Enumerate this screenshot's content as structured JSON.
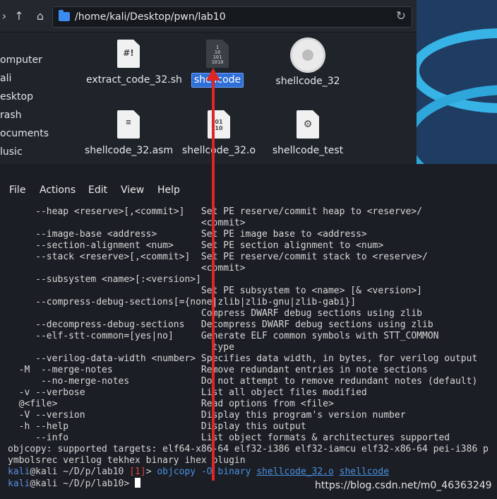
{
  "file_manager": {
    "path": "/home/kali/Desktop/pwn/lab10",
    "sidebar": [
      "omputer",
      "ali",
      "esktop",
      "rash",
      "ocuments",
      "lusic"
    ],
    "files": [
      {
        "name": "extract_code_32.sh",
        "icon": "script-file-icon"
      },
      {
        "name": "shellcode",
        "icon": "binary-file-icon",
        "selected": true
      },
      {
        "name": "shellcode_32",
        "icon": "executable-gear-icon"
      },
      {
        "name": "shellcode_32.asm",
        "icon": "text-file-icon"
      },
      {
        "name": "shellcode_32.o",
        "icon": "object-file-icon"
      },
      {
        "name": "shellcode_test",
        "icon": "executable-file-icon"
      }
    ]
  },
  "terminal": {
    "menu": [
      "File",
      "Actions",
      "Edit",
      "View",
      "Help"
    ],
    "help_lines": [
      "     --heap <reserve>[,<commit>]   Set PE reserve/commit heap to <reserve>/",
      "                                   <commit>",
      "     --image-base <address>        Set PE image base to <address>",
      "     --section-alignment <num>     Set PE section alignment to <num>",
      "     --stack <reserve>[,<commit>]  Set PE reserve/commit stack to <reserve>/",
      "                                   <commit>",
      "     --subsystem <name>[:<version>]",
      "                                   Set PE subsystem to <name> [& <version>]",
      "     --compress-debug-sections[={none|zlib|zlib-gnu|zlib-gabi}]",
      "                                   Compress DWARF debug sections using zlib",
      "     --decompress-debug-sections   Decompress DWARF debug sections using zlib",
      "     --elf-stt-common=[yes|no]     Generate ELF common symbols with STT_COMMON",
      "                                     type",
      "     --verilog-data-width <number> Specifies data width, in bytes, for verilog output",
      "  -M  --merge-notes                Remove redundant entries in note sections",
      "      --no-merge-notes             Do not attempt to remove redundant notes (default)",
      "  -v --verbose                     List all object files modified",
      "  @<file>                          Read options from <file>",
      "  -V --version                     Display this program's version number",
      "  -h --help                        Display this output",
      "     --info                        List object formats & architectures supported",
      "objcopy: supported targets: elf64-x86-64 elf32-i386 elf32-iamcu elf32-x86-64 pei-i386 p",
      "ymbolsrec verilog tekhex binary ihex plugin"
    ],
    "prompt1": {
      "user": "kali",
      "at_host": "@kali",
      "path": " ~/D/p/lab10 ",
      "status": "[1]",
      "arrow": "> ",
      "cmd": "objcopy -O binary ",
      "arg1": "shellcode_32.o",
      "space": " ",
      "arg2": "shellcode"
    },
    "prompt2": {
      "user": "kali",
      "at_host": "@kali",
      "path": " ~/D/p/lab10",
      "arrow": "> "
    }
  },
  "watermark": "https://blog.csdn.net/m0_46363249",
  "colors": {
    "annotation_arrow": "#e02525",
    "selection": "#2f6fd8",
    "prompt_user": "#5b8fe0",
    "prompt_error": "#e0453c"
  }
}
